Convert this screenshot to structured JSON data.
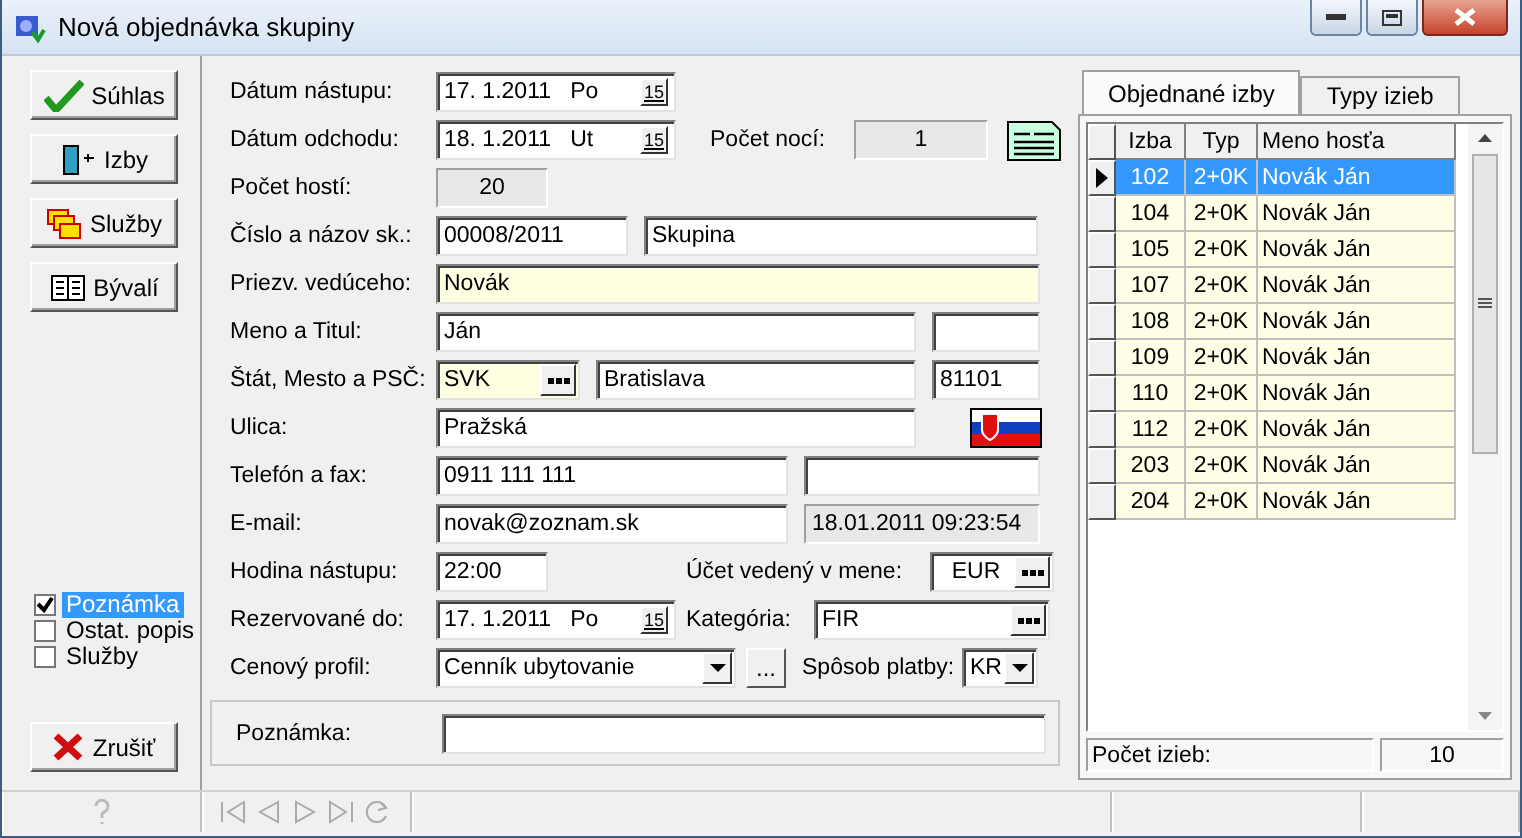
{
  "window": {
    "title": "Nová objednávka skupiny"
  },
  "side_buttons": [
    {
      "label": "Súhlas",
      "kind": "check"
    },
    {
      "label": "Izby",
      "kind": "door"
    },
    {
      "label": "Služby",
      "kind": "services"
    },
    {
      "label": "Bývalí",
      "kind": "book"
    }
  ],
  "sections": [
    {
      "label": "Poznámka",
      "checked": true,
      "selected": true
    },
    {
      "label": "Ostat. popis",
      "checked": false,
      "selected": false
    },
    {
      "label": "Služby",
      "checked": false,
      "selected": false
    }
  ],
  "cancel_button": {
    "label": "Zrušiť"
  },
  "form": {
    "arrival": {
      "label": "Dátum nástupu:",
      "value": "17. 1.2011   Po",
      "calendar": "15"
    },
    "departure": {
      "label": "Dátum odchodu:",
      "value": "18. 1.2011   Ut",
      "calendar": "15"
    },
    "nights": {
      "label": "Počet nocí:",
      "value": "1"
    },
    "guests": {
      "label": "Počet hostí:",
      "value": "20"
    },
    "group": {
      "label": "Číslo a názov sk.:",
      "number": "00008/2011",
      "name": "Skupina"
    },
    "leader_surname": {
      "label": "Priezv. vedúceho:",
      "value": "Novák"
    },
    "name_title": {
      "label": "Meno a Titul:",
      "name": "Ján"
    },
    "address": {
      "label": "Štát, Mesto a PSČ:",
      "country": "SVK",
      "city": "Bratislava",
      "zip": "81101"
    },
    "street": {
      "label": "Ulica:",
      "value": "Pražská"
    },
    "phone": {
      "label": "Telefón a fax:",
      "phone": "0911 111 111"
    },
    "email": {
      "label": "E-mail:",
      "value": "novak@zoznam.sk",
      "timestamp": "18.01.2011 09:23:54"
    },
    "arrival_hour": {
      "label": "Hodina nástupu:",
      "value": "22:00"
    },
    "currency": {
      "label": "Účet vedený v mene:",
      "value": "EUR"
    },
    "reserved_until": {
      "label": "Rezervované do:",
      "value": "17. 1.2011   Po",
      "calendar": "15"
    },
    "category": {
      "label": "Kategória:",
      "value": "FIR"
    },
    "price_profile": {
      "label": "Cenový profil:",
      "value": "Cenník ubytovanie",
      "more": "..."
    },
    "payment": {
      "label": "Spôsob platby:",
      "value": "KR"
    },
    "note": {
      "label": "Poznámka:"
    }
  },
  "tabs": [
    {
      "label": "Objednané izby",
      "selected": true
    },
    {
      "label": "Typy izieb",
      "selected": false
    }
  ],
  "table": {
    "columns": [
      "Izba",
      "Typ",
      "Meno hosťa"
    ],
    "rows": [
      {
        "room": "102",
        "type": "2+0K",
        "guest": "Novák Ján",
        "selected": true
      },
      {
        "room": "104",
        "type": "2+0K",
        "guest": "Novák Ján",
        "selected": false
      },
      {
        "room": "105",
        "type": "2+0K",
        "guest": "Novák Ján",
        "selected": false
      },
      {
        "room": "107",
        "type": "2+0K",
        "guest": "Novák Ján",
        "selected": false
      },
      {
        "room": "108",
        "type": "2+0K",
        "guest": "Novák Ján",
        "selected": false
      },
      {
        "room": "109",
        "type": "2+0K",
        "guest": "Novák Ján",
        "selected": false
      },
      {
        "room": "110",
        "type": "2+0K",
        "guest": "Novák Ján",
        "selected": false
      },
      {
        "room": "112",
        "type": "2+0K",
        "guest": "Novák Ján",
        "selected": false
      },
      {
        "room": "203",
        "type": "2+0K",
        "guest": "Novák Ján",
        "selected": false
      },
      {
        "room": "204",
        "type": "2+0K",
        "guest": "Novák Ján",
        "selected": false
      }
    ]
  },
  "room_count": {
    "label": "Počet izieb:",
    "value": "10"
  }
}
